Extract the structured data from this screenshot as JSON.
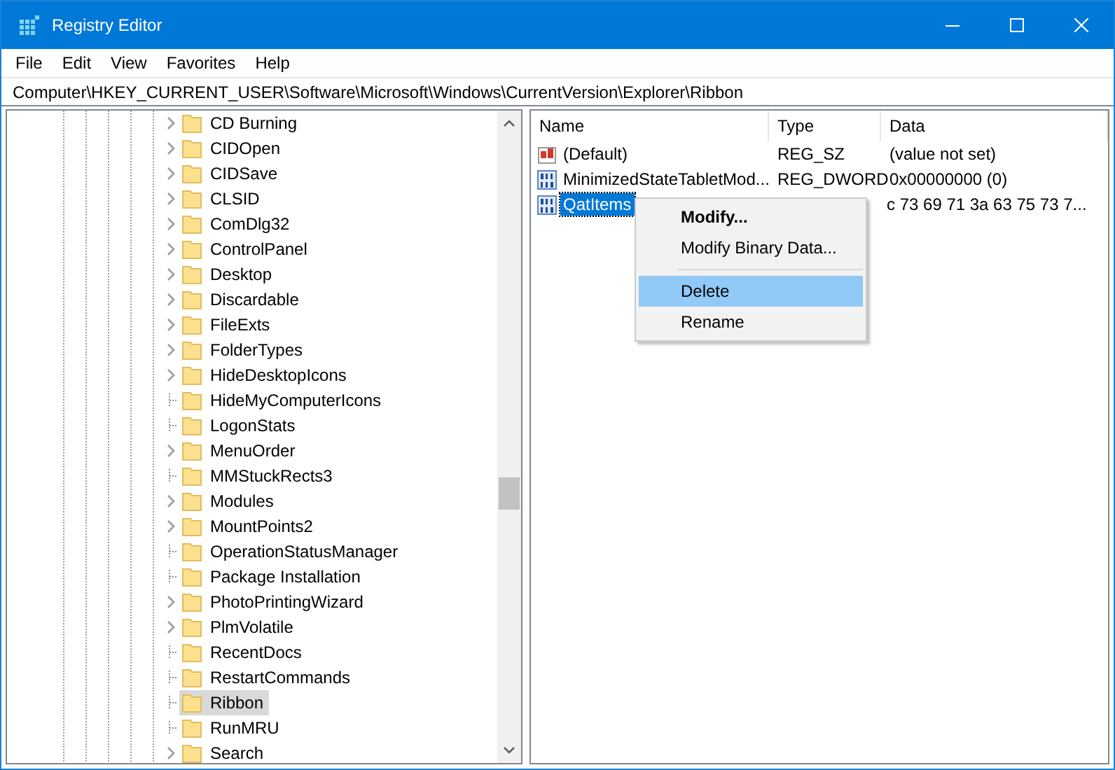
{
  "window": {
    "title": "Registry Editor"
  },
  "menu_bar": [
    "File",
    "Edit",
    "View",
    "Favorites",
    "Help"
  ],
  "address_bar": {
    "value": "Computer\\HKEY_CURRENT_USER\\Software\\Microsoft\\Windows\\CurrentVersion\\Explorer\\Ribbon"
  },
  "tree": {
    "items": [
      {
        "label": "CD Burning",
        "expandable": true,
        "selected": false
      },
      {
        "label": "CIDOpen",
        "expandable": true,
        "selected": false
      },
      {
        "label": "CIDSave",
        "expandable": true,
        "selected": false
      },
      {
        "label": "CLSID",
        "expandable": true,
        "selected": false
      },
      {
        "label": "ComDlg32",
        "expandable": true,
        "selected": false
      },
      {
        "label": "ControlPanel",
        "expandable": true,
        "selected": false
      },
      {
        "label": "Desktop",
        "expandable": true,
        "selected": false
      },
      {
        "label": "Discardable",
        "expandable": true,
        "selected": false
      },
      {
        "label": "FileExts",
        "expandable": true,
        "selected": false
      },
      {
        "label": "FolderTypes",
        "expandable": true,
        "selected": false
      },
      {
        "label": "HideDesktopIcons",
        "expandable": true,
        "selected": false
      },
      {
        "label": "HideMyComputerIcons",
        "expandable": false,
        "selected": false
      },
      {
        "label": "LogonStats",
        "expandable": false,
        "selected": false
      },
      {
        "label": "MenuOrder",
        "expandable": true,
        "selected": false
      },
      {
        "label": "MMStuckRects3",
        "expandable": false,
        "selected": false
      },
      {
        "label": "Modules",
        "expandable": true,
        "selected": false
      },
      {
        "label": "MountPoints2",
        "expandable": true,
        "selected": false
      },
      {
        "label": "OperationStatusManager",
        "expandable": false,
        "selected": false
      },
      {
        "label": "Package Installation",
        "expandable": false,
        "selected": false
      },
      {
        "label": "PhotoPrintingWizard",
        "expandable": true,
        "selected": false
      },
      {
        "label": "PlmVolatile",
        "expandable": true,
        "selected": false
      },
      {
        "label": "RecentDocs",
        "expandable": false,
        "selected": false
      },
      {
        "label": "RestartCommands",
        "expandable": false,
        "selected": false
      },
      {
        "label": "Ribbon",
        "expandable": false,
        "selected": true
      },
      {
        "label": "RunMRU",
        "expandable": false,
        "selected": false
      },
      {
        "label": "Search",
        "expandable": true,
        "selected": false
      }
    ]
  },
  "values": {
    "columns": [
      "Name",
      "Type",
      "Data"
    ],
    "rows": [
      {
        "kind": "string",
        "name": "(Default)",
        "type": "REG_SZ",
        "data": "(value not set)",
        "selected": false
      },
      {
        "kind": "binary",
        "name": "MinimizedStateTabletMod...",
        "type": "REG_DWORD",
        "data": "0x00000000 (0)",
        "selected": false
      },
      {
        "kind": "binary",
        "name": "QatItems",
        "data": "c 73 69 71 3a 63 75 73 7...",
        "selected": true
      }
    ]
  },
  "context_menu": {
    "items": [
      {
        "kind": "item",
        "label": "Modify...",
        "default": true,
        "selected": false
      },
      {
        "kind": "item",
        "label": "Modify Binary Data...",
        "default": false,
        "selected": false
      },
      {
        "kind": "separator"
      },
      {
        "kind": "item",
        "label": "Delete",
        "default": false,
        "selected": true
      },
      {
        "kind": "item",
        "label": "Rename",
        "default": false,
        "selected": false
      }
    ]
  }
}
